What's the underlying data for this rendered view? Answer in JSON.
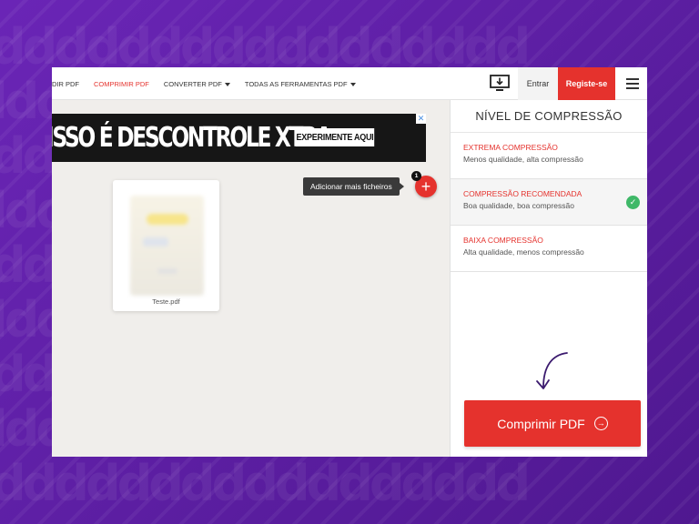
{
  "nav": {
    "items": [
      {
        "label": "DIR PDF",
        "active": false,
        "caret": false
      },
      {
        "label": "COMPRIMIR PDF",
        "active": true,
        "caret": false
      },
      {
        "label": "CONVERTER PDF",
        "active": false,
        "caret": true
      },
      {
        "label": "TODAS AS FERRAMENTAS PDF",
        "active": false,
        "caret": true
      }
    ],
    "desktop_icon": "desktop-download-icon",
    "login_label": "Entrar",
    "register_label": "Registe-se",
    "menu_icon": "hamburger-menu-icon"
  },
  "ad": {
    "headline": "ISSO É DESCONTROLE XTRA",
    "cta": "EXPERIMENTE AQUI",
    "close_icon": "ad-close-icon"
  },
  "upload": {
    "add_more_label": "Adicionar mais ficheiros",
    "file_count": "1",
    "add_icon": "plus-icon"
  },
  "files": [
    {
      "name": "Teste.pdf"
    }
  ],
  "sidebar": {
    "title": "NÍVEL DE COMPRESSÃO",
    "options": [
      {
        "title": "EXTREMA COMPRESSÃO",
        "desc": "Menos qualidade, alta compressão",
        "selected": false
      },
      {
        "title": "COMPRESSÃO RECOMENDADA",
        "desc": "Boa qualidade, boa compressão",
        "selected": true
      },
      {
        "title": "BAIXA COMPRESSÃO",
        "desc": "Alta qualidade, menos compressão",
        "selected": false
      }
    ],
    "action_label": "Comprimir PDF"
  },
  "colors": {
    "brand_red": "#e5322d",
    "background_purple": "#5b1fa0",
    "check_green": "#3fb868"
  }
}
